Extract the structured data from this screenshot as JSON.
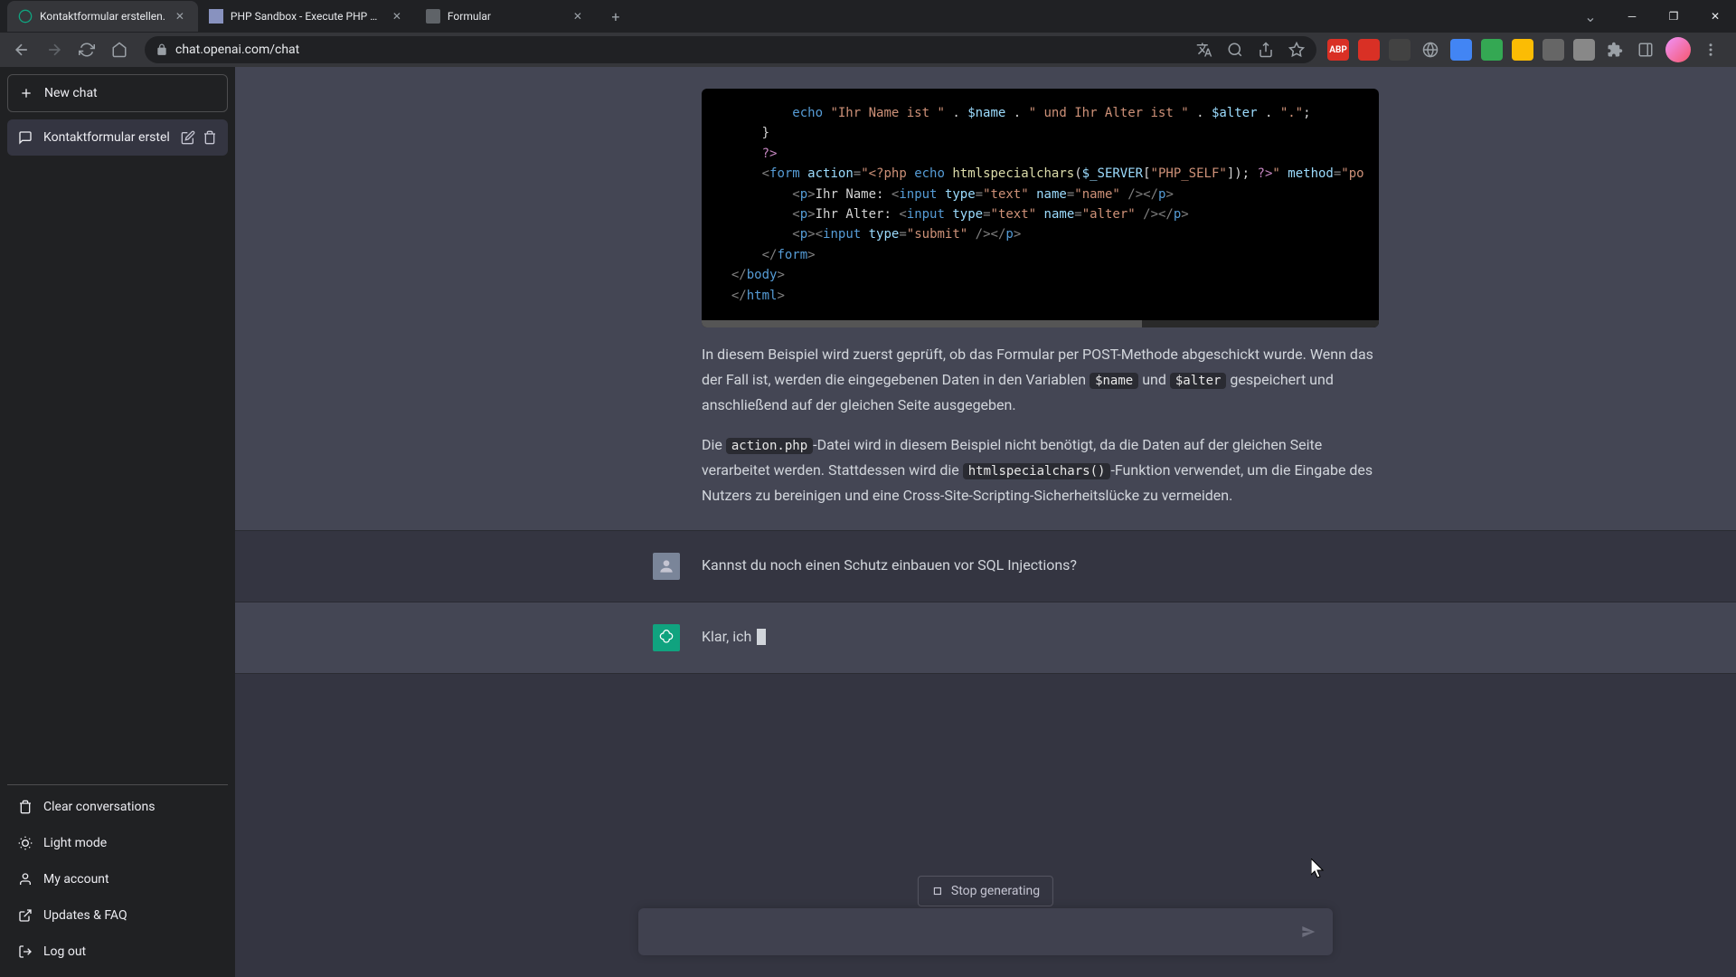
{
  "browser": {
    "tabs": [
      {
        "title": "Kontaktformular erstellen.",
        "active": true
      },
      {
        "title": "PHP Sandbox - Execute PHP cod",
        "active": false
      },
      {
        "title": "Formular",
        "active": false
      }
    ],
    "url": "chat.openai.com/chat"
  },
  "sidebar": {
    "new_chat": "New chat",
    "chats": [
      {
        "title": "Kontaktformular erstell"
      }
    ],
    "footer": {
      "clear": "Clear conversations",
      "light": "Light mode",
      "account": "My account",
      "faq": "Updates & FAQ",
      "logout": "Log out"
    }
  },
  "conversation": {
    "code_lines": [
      {
        "indent": 5,
        "tokens": [
          [
            "kw",
            "echo"
          ],
          [
            "white",
            " "
          ],
          [
            "str",
            "\"Ihr Name ist \""
          ],
          [
            "white",
            " . "
          ],
          [
            "var",
            "$name"
          ],
          [
            "white",
            " . "
          ],
          [
            "str",
            "\" und Ihr Alter ist \""
          ],
          [
            "white",
            " . "
          ],
          [
            "var",
            "$alter"
          ],
          [
            "white",
            " . "
          ],
          [
            "str",
            "\".\""
          ],
          [
            "white",
            ";"
          ]
        ]
      },
      {
        "indent": 3,
        "tokens": [
          [
            "white",
            "}"
          ]
        ]
      },
      {
        "indent": 3,
        "tokens": [
          [
            "php",
            "?>"
          ]
        ]
      },
      {
        "indent": 3,
        "tokens": [
          [
            "tag",
            "<"
          ],
          [
            "tagname",
            "form"
          ],
          [
            "white",
            " "
          ],
          [
            "attr",
            "action"
          ],
          [
            "tag",
            "="
          ],
          [
            "str",
            "\"<?php "
          ],
          [
            "kw",
            "echo"
          ],
          [
            "white",
            " "
          ],
          [
            "func",
            "htmlspecialchars"
          ],
          [
            "white",
            "("
          ],
          [
            "var",
            "$_SERVER"
          ],
          [
            "white",
            "["
          ],
          [
            "str",
            "\"PHP_SELF\""
          ],
          [
            "white",
            "]); "
          ],
          [
            "php",
            "?>"
          ],
          [
            "str",
            "\""
          ],
          [
            "white",
            " "
          ],
          [
            "attr",
            "method"
          ],
          [
            "tag",
            "="
          ],
          [
            "str",
            "\"po"
          ]
        ]
      },
      {
        "indent": 5,
        "tokens": [
          [
            "tag",
            "<"
          ],
          [
            "tagname",
            "p"
          ],
          [
            "tag",
            ">"
          ],
          [
            "white",
            "Ihr Name: "
          ],
          [
            "tag",
            "<"
          ],
          [
            "tagname",
            "input"
          ],
          [
            "white",
            " "
          ],
          [
            "attr",
            "type"
          ],
          [
            "tag",
            "="
          ],
          [
            "str",
            "\"text\""
          ],
          [
            "white",
            " "
          ],
          [
            "attr",
            "name"
          ],
          [
            "tag",
            "="
          ],
          [
            "str",
            "\"name\""
          ],
          [
            "white",
            " "
          ],
          [
            "tag",
            "/></"
          ],
          [
            "tagname",
            "p"
          ],
          [
            "tag",
            ">"
          ]
        ]
      },
      {
        "indent": 5,
        "tokens": [
          [
            "tag",
            "<"
          ],
          [
            "tagname",
            "p"
          ],
          [
            "tag",
            ">"
          ],
          [
            "white",
            "Ihr Alter: "
          ],
          [
            "tag",
            "<"
          ],
          [
            "tagname",
            "input"
          ],
          [
            "white",
            " "
          ],
          [
            "attr",
            "type"
          ],
          [
            "tag",
            "="
          ],
          [
            "str",
            "\"text\""
          ],
          [
            "white",
            " "
          ],
          [
            "attr",
            "name"
          ],
          [
            "tag",
            "="
          ],
          [
            "str",
            "\"alter\""
          ],
          [
            "white",
            " "
          ],
          [
            "tag",
            "/></"
          ],
          [
            "tagname",
            "p"
          ],
          [
            "tag",
            ">"
          ]
        ]
      },
      {
        "indent": 5,
        "tokens": [
          [
            "tag",
            "<"
          ],
          [
            "tagname",
            "p"
          ],
          [
            "tag",
            "><"
          ],
          [
            "tagname",
            "input"
          ],
          [
            "white",
            " "
          ],
          [
            "attr",
            "type"
          ],
          [
            "tag",
            "="
          ],
          [
            "str",
            "\"submit\""
          ],
          [
            "white",
            " "
          ],
          [
            "tag",
            "/></"
          ],
          [
            "tagname",
            "p"
          ],
          [
            "tag",
            ">"
          ]
        ]
      },
      {
        "indent": 3,
        "tokens": [
          [
            "tag",
            "</"
          ],
          [
            "tagname",
            "form"
          ],
          [
            "tag",
            ">"
          ]
        ]
      },
      {
        "indent": 1,
        "tokens": [
          [
            "tag",
            "</"
          ],
          [
            "tagname",
            "body"
          ],
          [
            "tag",
            ">"
          ]
        ]
      },
      {
        "indent": 1,
        "tokens": [
          [
            "tag",
            "</"
          ],
          [
            "tagname",
            "html"
          ],
          [
            "tag",
            ">"
          ]
        ]
      }
    ],
    "para1_pre": "In diesem Beispiel wird zuerst geprüft, ob das Formular per POST-Methode abgeschickt wurde. Wenn das der Fall ist, werden die eingegebenen Daten in den Variablen ",
    "para1_code1": "$name",
    "para1_mid": " und ",
    "para1_code2": "$alter",
    "para1_post": " gespeichert und anschließend auf der gleichen Seite ausgegeben.",
    "para2_pre": "Die ",
    "para2_code1": "action.php",
    "para2_mid": "-Datei wird in diesem Beispiel nicht benötigt, da die Daten auf der gleichen Seite verarbeitet werden. Stattdessen wird die ",
    "para2_code2": "htmlspecialchars()",
    "para2_post": "-Funktion verwendet, um die Eingabe des Nutzers zu bereinigen und eine Cross-Site-Scripting-Sicherheitslücke zu vermeiden.",
    "user_msg": "Kannst du noch einen Schutz einbauen vor SQL Injections?",
    "assistant_partial": "Klar, ich ",
    "stop_label": "Stop generating"
  }
}
